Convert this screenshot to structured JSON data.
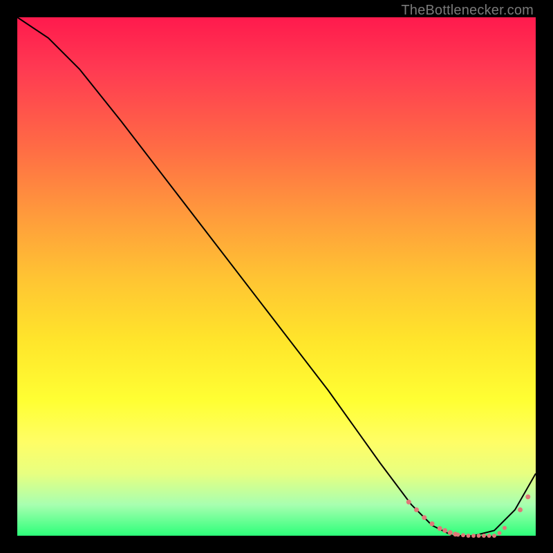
{
  "watermark": "TheBottlenecker.com",
  "chart_data": {
    "type": "line",
    "title": "",
    "xlabel": "",
    "ylabel": "",
    "xlim": [
      0,
      100
    ],
    "ylim": [
      0,
      100
    ],
    "series": [
      {
        "name": "curve",
        "x": [
          0,
          6,
          12,
          20,
          30,
          40,
          50,
          60,
          70,
          76,
          80,
          84,
          88,
          92,
          96,
          100
        ],
        "y": [
          100,
          96,
          90,
          80,
          67,
          54,
          41,
          28,
          14,
          6,
          2,
          0,
          0,
          1,
          5,
          12
        ]
      }
    ],
    "markers": {
      "name": "dots",
      "x": [
        75.5,
        77,
        78.5,
        80,
        81.5,
        82.5,
        83.5,
        84.5,
        85,
        86,
        87,
        88,
        89,
        90,
        91,
        92,
        93,
        94,
        97,
        98.5
      ],
      "y": [
        6.5,
        5,
        3.5,
        2.3,
        1.4,
        1.0,
        0.6,
        0.3,
        0.2,
        0.1,
        0,
        0,
        0,
        0,
        0,
        0,
        0.5,
        1.5,
        5,
        7.5
      ],
      "r": [
        3.5,
        3.5,
        3.5,
        3.5,
        3.5,
        3.5,
        3.5,
        3.5,
        3,
        3,
        3,
        3,
        3,
        3,
        3,
        3,
        3,
        3,
        3.5,
        3.5
      ]
    },
    "colors": {
      "line": "#000000",
      "marker": "#e07878"
    }
  }
}
